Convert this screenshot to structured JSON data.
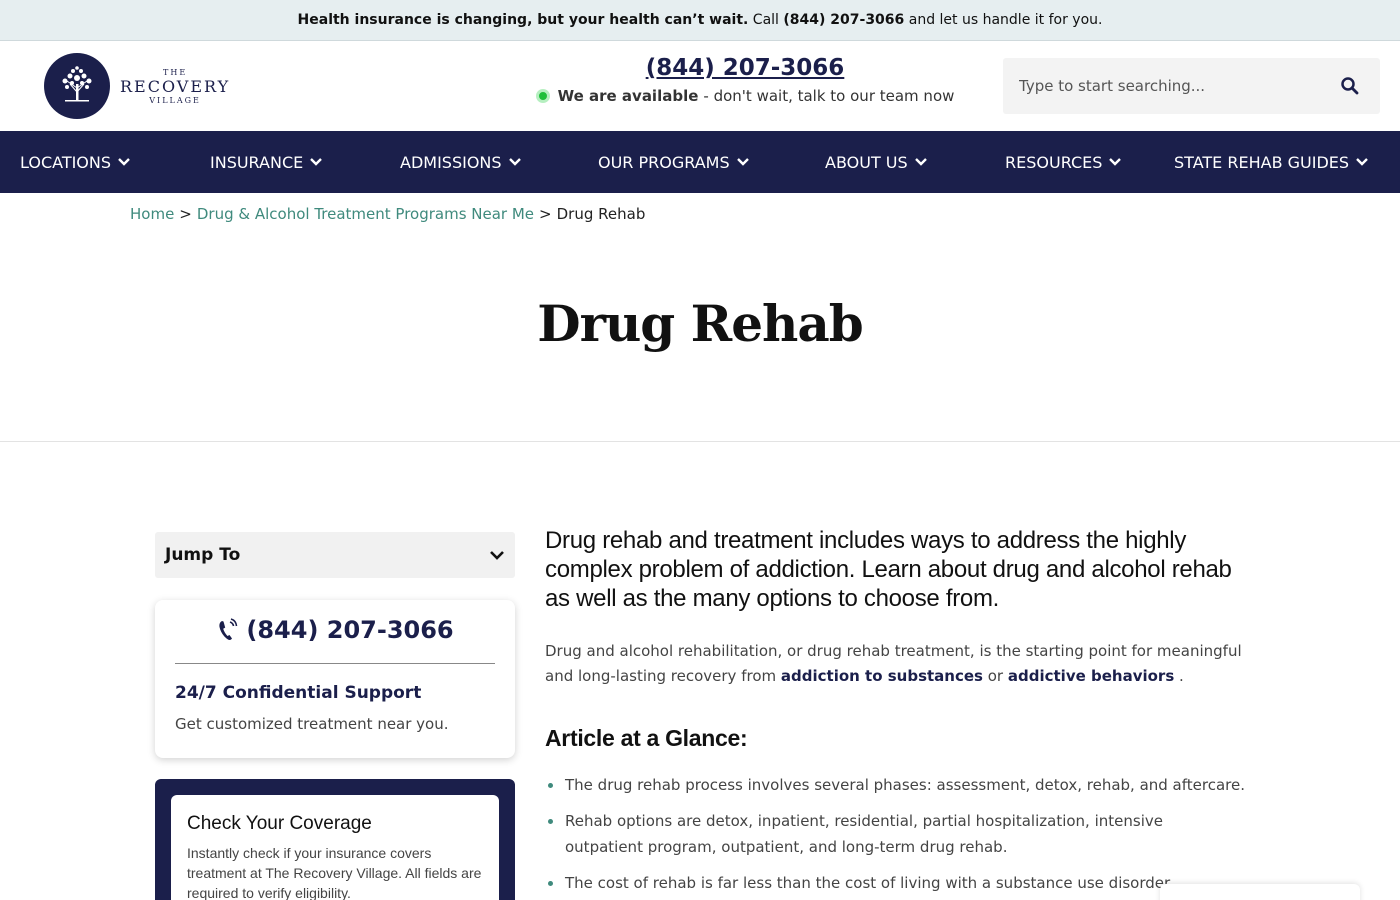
{
  "announcement": {
    "bold": "Health insurance is changing, but your health can’t wait.",
    "pre": " Call ",
    "phone": "(844) 207-3066",
    "post": " and let us handle it for you."
  },
  "logo": {
    "the": "THE",
    "recovery": "RECOVERY",
    "village": "VILLAGE",
    "icon": "tree-icon"
  },
  "header": {
    "phone": "(844) 207-3066",
    "available_bold": "We are available",
    "available_rest": "- don't wait, talk to our team now"
  },
  "search": {
    "placeholder": "Type to start searching...",
    "icon": "search-icon"
  },
  "nav": {
    "items": [
      {
        "label": "LOCATIONS"
      },
      {
        "label": "INSURANCE"
      },
      {
        "label": "ADMISSIONS"
      },
      {
        "label": "OUR PROGRAMS"
      },
      {
        "label": "ABOUT US"
      },
      {
        "label": "RESOURCES"
      },
      {
        "label": "STATE REHAB GUIDES"
      }
    ]
  },
  "breadcrumb": {
    "home": "Home",
    "sep": ">",
    "parent": "Drug & Alcohol Treatment Programs Near Me",
    "current": "Drug Rehab"
  },
  "page": {
    "title": "Drug Rehab"
  },
  "sidebar": {
    "jump_to": "Jump To",
    "support_card": {
      "phone": "(844) 207-3066",
      "heading": "24/7 Confidential Support",
      "sub": "Get customized treatment near you."
    },
    "coverage": {
      "title": "Check Your Coverage",
      "text": "Instantly check if your insurance covers treatment at The Recovery Village. All fields are required to verify eligibility."
    }
  },
  "article": {
    "lead": "Drug rehab and treatment includes ways to address the highly complex problem of addiction. Learn about drug and alcohol rehab as well as the many options to choose from.",
    "intro_pre": "Drug and alcohol rehabilitation, or drug rehab treatment, is the starting point for meaningful and long-lasting recovery from ",
    "link1": "addiction to substances",
    "intro_mid": " or ",
    "link2": "addictive behaviors",
    "intro_post": " .",
    "glance_title": "Article at a Glance:",
    "bullets": [
      "The drug rehab process involves several phases: assessment, detox, rehab, and aftercare.",
      "Rehab options are detox, inpatient, residential, partial hospitalization, intensive outpatient program, outpatient, and long-term drug rehab.",
      "The cost of rehab is far less than the cost of living with a substance use disorder."
    ]
  },
  "colors": {
    "navy": "#1b1f4b",
    "teal_link": "#3f8a7d",
    "available_green": "#1fbf3a",
    "announce_bg": "#e6eef0"
  }
}
